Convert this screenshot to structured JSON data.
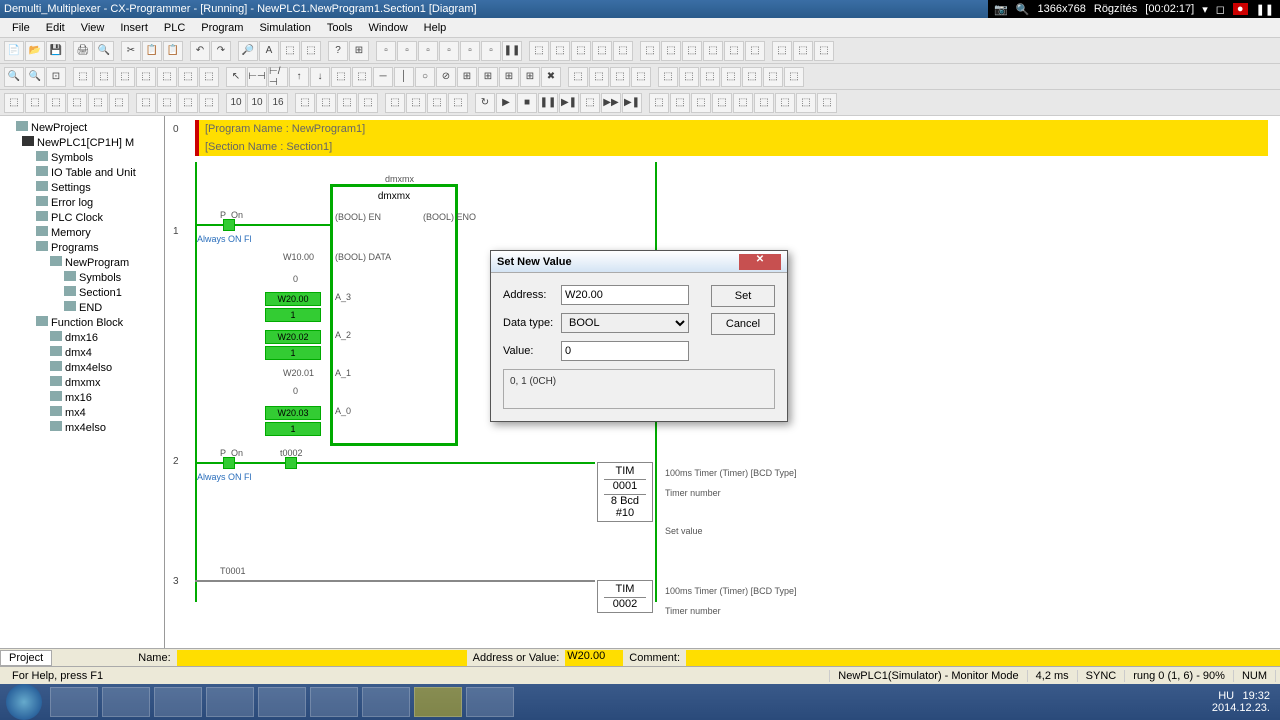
{
  "title": "Demulti_Multiplexer - CX-Programmer - [Running] - NewPLC1.NewProgram1.Section1 [Diagram]",
  "sys": {
    "res": "1366x768",
    "rec": "Rögzítés",
    "rectime": "[00:02:17]"
  },
  "menu": [
    "File",
    "Edit",
    "View",
    "Insert",
    "PLC",
    "Program",
    "Simulation",
    "Tools",
    "Window",
    "Help"
  ],
  "tree": {
    "root": "NewProject",
    "plc": "NewPLC1[CP1H] M",
    "items": [
      "Symbols",
      "IO Table and Unit",
      "Settings",
      "Error log",
      "PLC Clock",
      "Memory"
    ],
    "programs": "Programs",
    "prog": "NewProgram",
    "prog_items": [
      "Symbols",
      "Section1",
      "END"
    ],
    "fb": "Function Block",
    "fbs": [
      "dmx16",
      "dmx4",
      "dmx4elso",
      "dmxmx",
      "mx16",
      "mx4",
      "mx4elso"
    ]
  },
  "ladder": {
    "prog_name": "[Program Name : NewProgram1]",
    "sect_name": "[Section Name : Section1]",
    "fb_name": "dmxmx",
    "p_on": "P_On",
    "always_on": "Always ON Fl",
    "w10": "W10.00",
    "bool_en": "(BOOL) EN",
    "bool_eno": "(BOOL) ENO",
    "bool_data": "(BOOL) DATA",
    "a0": "A_0",
    "a1": "A_1",
    "a2": "A_2",
    "a3": "A_3",
    "w2000": "W20.00",
    "w2001": "W20.01",
    "w2002": "W20.02",
    "w2003": "W20.03",
    "val1": "1",
    "val0": "0",
    "t0001": "T0001",
    "tim": "TIM",
    "tim_desc": "100ms Timer (Timer) [BCD Type]",
    "tim_num": "Timer number",
    "tim_set": "Set value",
    "n0001": "0001",
    "n0002": "0002",
    "bcd8": "8 Bcd",
    "hash": "#10"
  },
  "dialog": {
    "title": "Set New Value",
    "addr_lbl": "Address:",
    "addr_val": "W20.00",
    "type_lbl": "Data type:",
    "type_val": "BOOL",
    "val_lbl": "Value:",
    "val_val": "0",
    "info": "0, 1 (0CH)",
    "set": "Set",
    "cancel": "Cancel"
  },
  "namebar": {
    "project": "Project",
    "name": "Name:",
    "addr": "Address or Value:",
    "addr_val": "W20.00",
    "comment": "Comment:"
  },
  "status": {
    "help": "For Help, press F1",
    "mode": "NewPLC1(Simulator) - Monitor Mode",
    "ms": "4,2 ms",
    "sync": "SYNC",
    "rung": "rung 0 (1, 6) - 90%",
    "num": "NUM"
  },
  "tray": {
    "lang": "HU",
    "time": "19:32",
    "date": "2014.12.23."
  }
}
